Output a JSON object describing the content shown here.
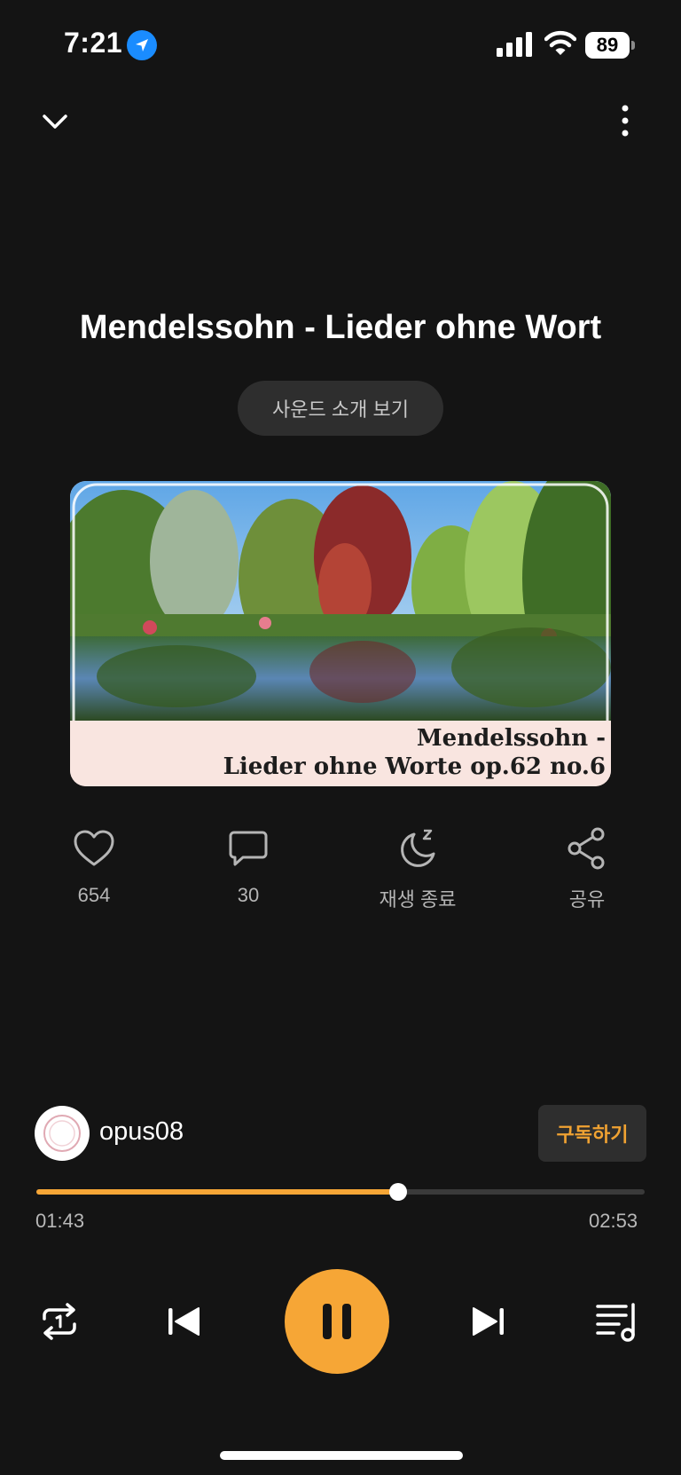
{
  "status_bar": {
    "time": "7:21",
    "battery": "89",
    "icons": [
      "location-icon",
      "signal-icon",
      "wifi-icon",
      "battery-icon"
    ]
  },
  "header": {
    "collapse_icon": "chevron-down-icon",
    "more_icon": "more-vertical-icon"
  },
  "track": {
    "title": "Mendelssohn - Lieder ohne Wort",
    "intro_button": "사운드 소개 보기"
  },
  "artwork": {
    "caption_line1": "Mendelssohn -",
    "caption_line2": "Lieder ohne Worte op.62 no.6"
  },
  "actions": [
    {
      "icon": "heart-icon",
      "label": "654"
    },
    {
      "icon": "comment-icon",
      "label": "30"
    },
    {
      "icon": "sleep-timer-icon",
      "label": "재생 종료"
    },
    {
      "icon": "share-icon",
      "label": "공유"
    }
  ],
  "channel": {
    "name": "opus08",
    "subscribe_label": "구독하기"
  },
  "progress": {
    "current": "01:43",
    "total": "02:53",
    "fraction": 0.595
  },
  "controls": {
    "icons": [
      "repeat-one-icon",
      "previous-icon",
      "pause-icon",
      "next-icon",
      "playlist-icon"
    ]
  },
  "colors": {
    "accent": "#f6a636",
    "background": "#141414",
    "button_bg": "#2e2e2e",
    "subscribe_text": "#f0a232"
  }
}
